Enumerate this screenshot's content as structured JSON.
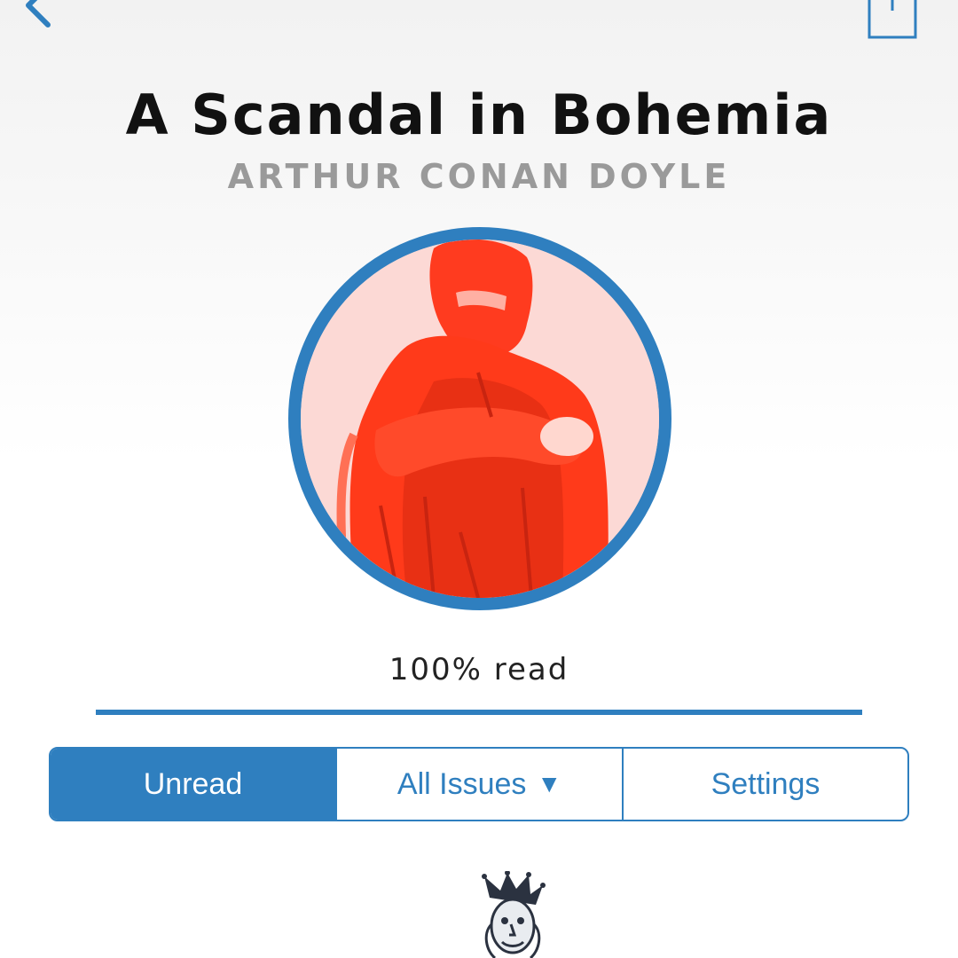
{
  "nav": {
    "back_icon": "chevron-left-icon",
    "share_icon": "share-icon",
    "accent_color": "#2f7fbf"
  },
  "book": {
    "title": "A Scandal in Bohemia",
    "author": "ARTHUR CONAN DOYLE",
    "cover_tint": "#ff3a1a"
  },
  "progress": {
    "label": "100% read",
    "fraction": 1.0
  },
  "segments": {
    "unread": "Unread",
    "all_issues": "All Issues",
    "all_issues_caret": "▼",
    "settings": "Settings",
    "selected": "unread"
  },
  "footer": {
    "logo_icon": "jester-logo-icon"
  }
}
